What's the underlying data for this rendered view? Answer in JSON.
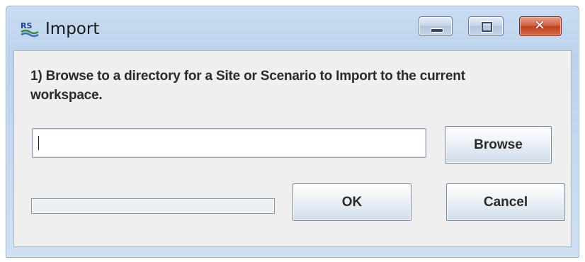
{
  "window": {
    "title": "Import",
    "app_icon_text": "RS"
  },
  "caption_buttons": {
    "minimize": "minimize",
    "maximize": "maximize",
    "close": "close"
  },
  "form": {
    "instructions": "1) Browse to a directory for a Site or Scenario to Import to the current workspace.",
    "path_value": "",
    "browse_label": "Browse",
    "ok_label": "OK",
    "cancel_label": "Cancel",
    "progress_fraction": 0
  },
  "colors": {
    "title_bar": "#bcd2ec",
    "close_button": "#c2401f",
    "client_background": "#efefef"
  }
}
